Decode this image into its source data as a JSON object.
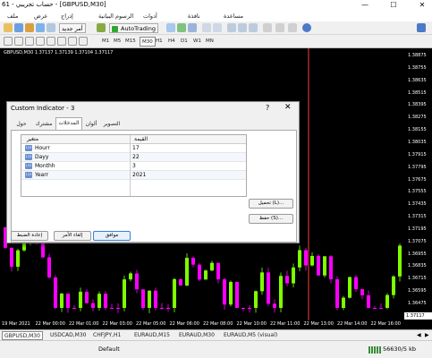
{
  "window": {
    "title": "61 - حساب تجريبي - [GBPUSD,M30]",
    "controls": [
      "—",
      "☐",
      "✕"
    ]
  },
  "menu": [
    "ملف",
    "عرض",
    "إدراج",
    "الرسوم البيانية",
    "أدوات",
    "نافذة",
    "مساعدة"
  ],
  "toolbar": {
    "new_order_label": "أمر جديد",
    "autotrading_label": "AutoTrading",
    "timeframes": [
      "M1",
      "M5",
      "M15",
      "M30",
      "H1",
      "H4",
      "D1",
      "W1",
      "MN"
    ],
    "active_timeframe": "M30"
  },
  "chart": {
    "header": "GBPUSD,M30  1.37137 1.37139 1.37104 1.37117",
    "bg": "#000000",
    "bull_color": "#7fff00",
    "bear_color": "#ff00ff",
    "current_price": "1.37117",
    "vline_color": "#ff3b3b",
    "price_labels": [
      "1.38875",
      "1.38755",
      "1.38635",
      "1.38515",
      "1.38395",
      "1.38275",
      "1.38155",
      "1.38035",
      "1.37915",
      "1.37795",
      "1.37675",
      "1.37555",
      "1.37435",
      "1.37315",
      "1.37195",
      "1.37075",
      "1.36955",
      "1.36835",
      "1.36715",
      "1.36595",
      "1.36475"
    ],
    "time_labels": [
      "19 Mar 2021",
      "22 Mar 00:00",
      "22 Mar 01:00",
      "22 Mar 03:00",
      "22 Mar 05:00",
      "22 Mar 06:00",
      "22 Mar 08:00",
      "22 Mar 10:00",
      "22 Mar 11:00",
      "22 Mar 13:00",
      "22 Mar 14:00",
      "22 Mar 16:00"
    ]
  },
  "dialog": {
    "title": "Custom Indicator - 3",
    "help": "?",
    "close": "✕",
    "tabs": [
      "حول",
      "مشترك",
      "المدخلات",
      "ألوان",
      "التصوير"
    ],
    "active_tab": "المدخلات",
    "columns": [
      "متغير",
      "القيمة"
    ],
    "params": [
      {
        "badge": "123",
        "name": "Hourr",
        "value": "17"
      },
      {
        "badge": "123",
        "name": "Dayy",
        "value": "22"
      },
      {
        "badge": "123",
        "name": "Monthh",
        "value": "3"
      },
      {
        "badge": "123",
        "name": "Yearr",
        "value": "2021"
      }
    ],
    "load_label": "تحميل (L)...",
    "save_label": "حفظ (S)...",
    "ok_label": "موافق",
    "cancel_label": "إلغاء الأمر",
    "reset_label": "إعادة الضبط"
  },
  "chart_tabs": [
    "GBPUSD,M30",
    "USDCAD,M30",
    "CHFJPY,H1",
    "EURAUD,M15",
    "EURAUD,M30",
    "EURAUD,M5 (visual)"
  ],
  "active_chart_tab": "GBPUSD,M30",
  "status": {
    "profile": "Default",
    "traffic": "56630/5 kb"
  }
}
